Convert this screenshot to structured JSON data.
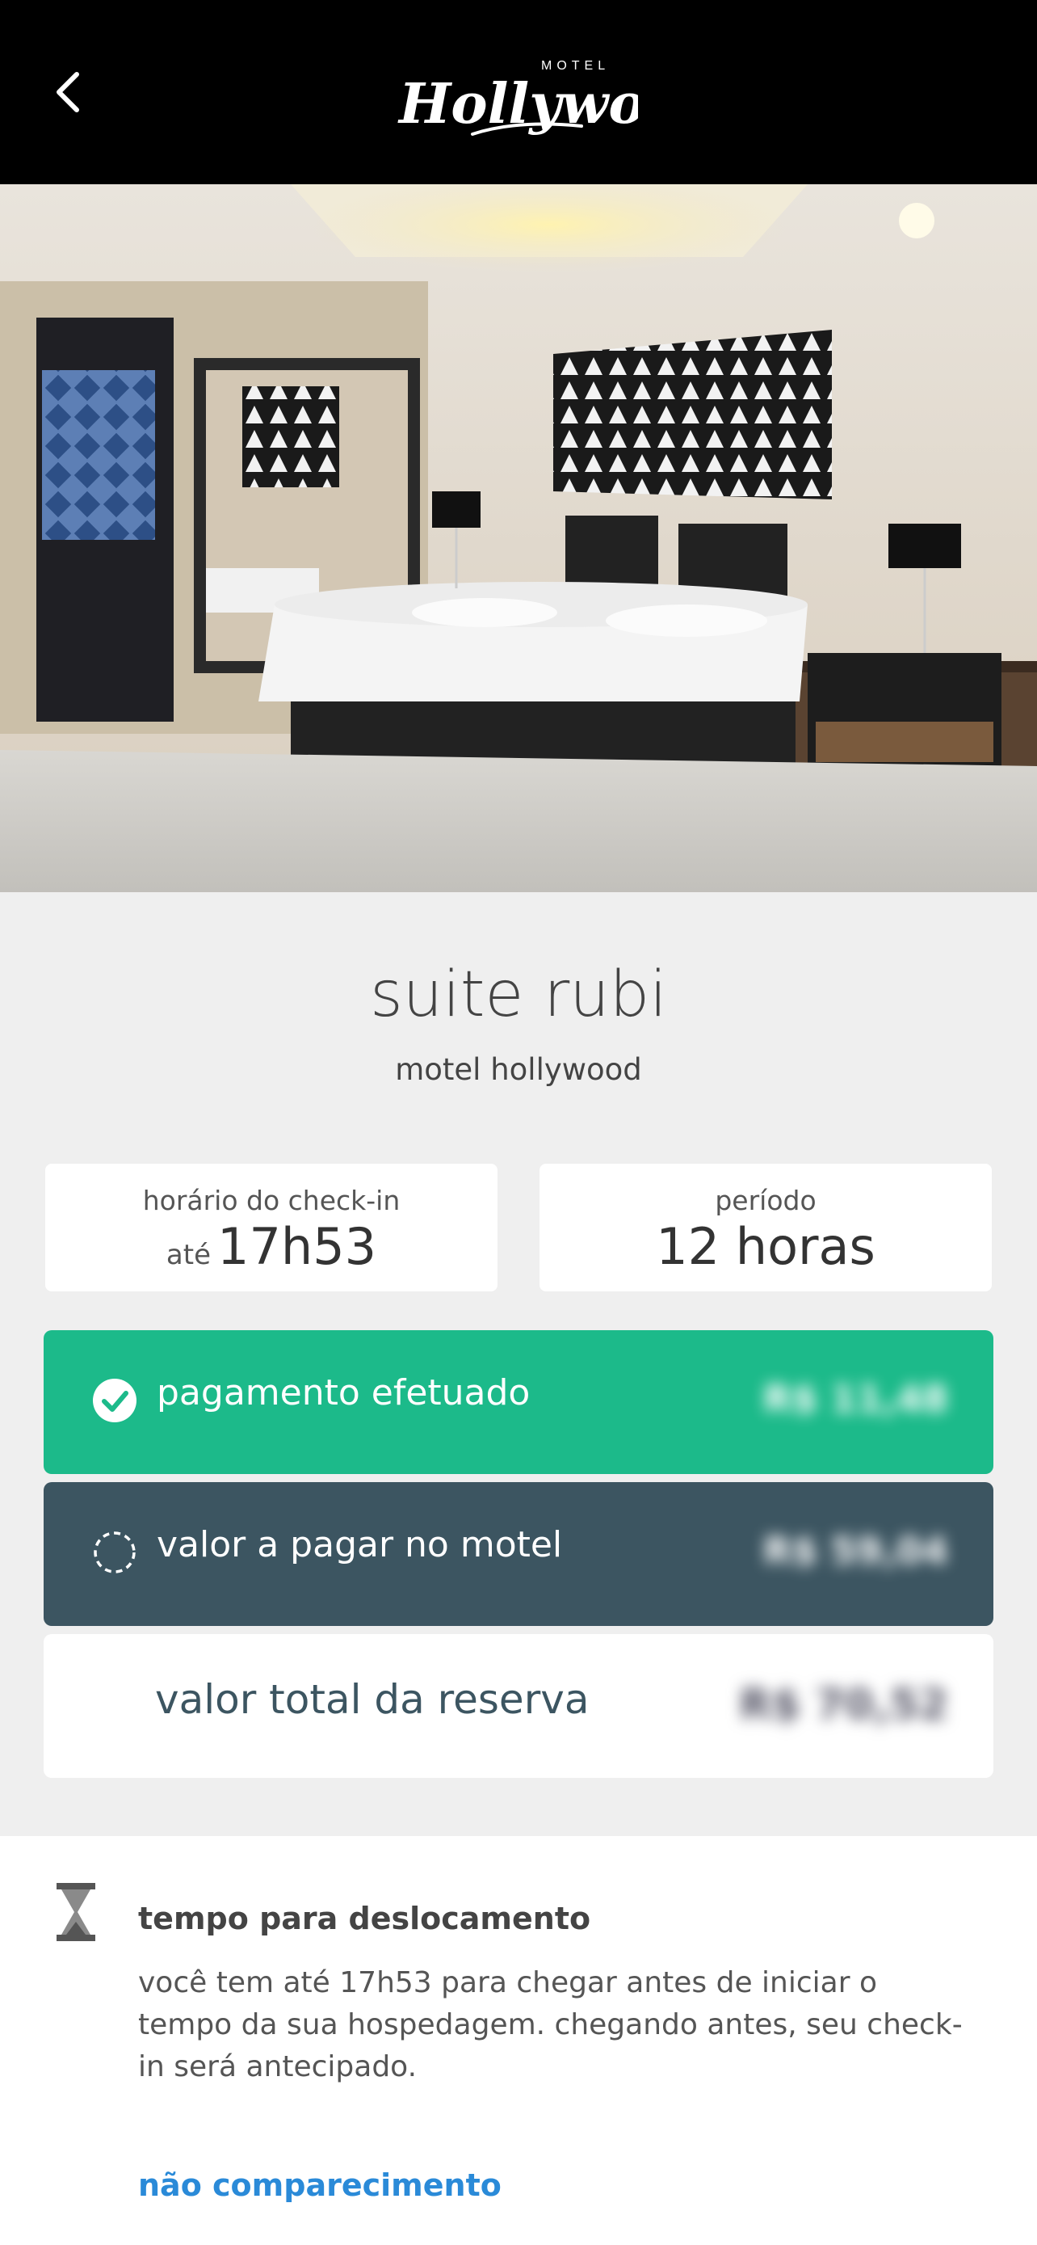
{
  "header": {
    "back_icon": "chevron-left-icon",
    "logo_small": "MOTEL",
    "logo_main": "Hollywood"
  },
  "suite": {
    "title": "suite rubi",
    "subtitle": "motel hollywood"
  },
  "checkin": {
    "label": "horário do check-in",
    "prefix": "até",
    "time": "17h53"
  },
  "period": {
    "label": "período",
    "value": "12 horas"
  },
  "payment": {
    "paid_label": "pagamento efetuado",
    "paid_amount": "R$ 11,48",
    "paid_icon": "check-circle-icon",
    "due_label": "valor a pagar no motel",
    "due_amount": "R$ 59,04",
    "due_icon": "dashed-circle-icon",
    "total_label": "valor total da reserva",
    "total_amount": "R$ 70,52"
  },
  "notice": {
    "icon": "hourglass-icon",
    "title": "tempo para deslocamento",
    "body": "você tem até 17h53 para chegar antes de iniciar o tempo da sua hospedagem. chegando antes, seu check-in será antecipado.",
    "link": "não comparecimento"
  },
  "colors": {
    "paid": "#1cba8a",
    "due": "#3c5561",
    "link": "#2a8ad8"
  }
}
